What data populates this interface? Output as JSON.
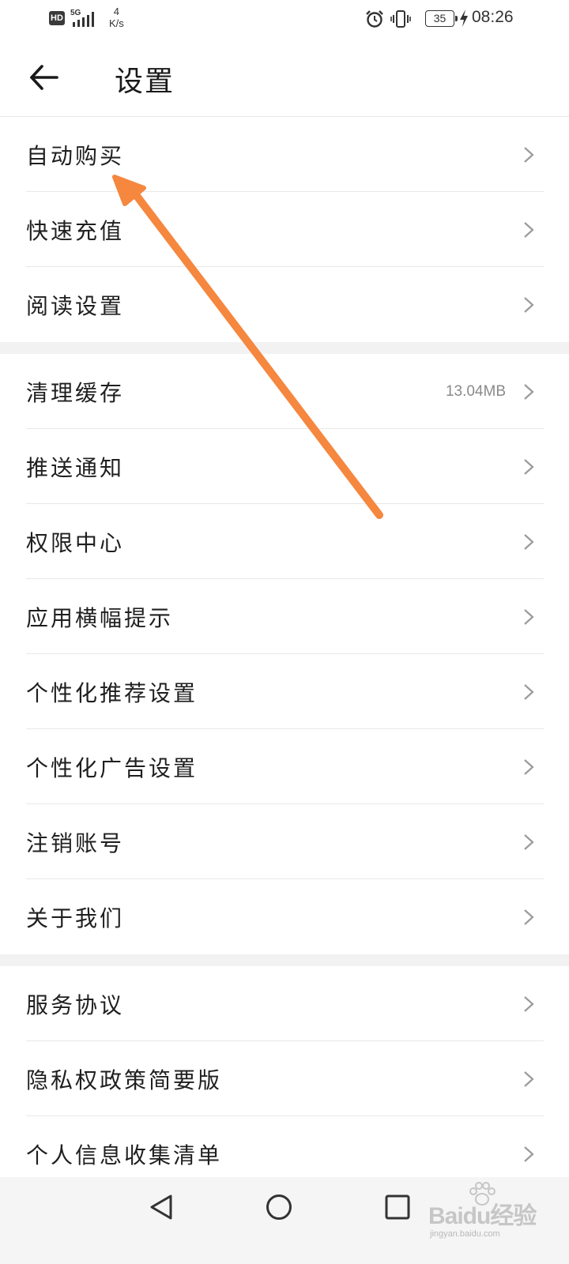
{
  "status_bar": {
    "hd": "HD",
    "network": "5G",
    "speed_value": "4",
    "speed_unit": "K/s",
    "battery": "35",
    "time": "08:26"
  },
  "header": {
    "title": "设置"
  },
  "sections": [
    {
      "items": [
        {
          "label": "自动购买"
        },
        {
          "label": "快速充值"
        },
        {
          "label": "阅读设置"
        }
      ]
    },
    {
      "items": [
        {
          "label": "清理缓存",
          "value": "13.04MB"
        },
        {
          "label": "推送通知"
        },
        {
          "label": "权限中心"
        },
        {
          "label": "应用横幅提示"
        },
        {
          "label": "个性化推荐设置"
        },
        {
          "label": "个性化广告设置"
        },
        {
          "label": "注销账号"
        },
        {
          "label": "关于我们"
        }
      ]
    },
    {
      "items": [
        {
          "label": "服务协议"
        },
        {
          "label": "隐私权政策简要版"
        },
        {
          "label": "个人信息收集清单"
        }
      ]
    }
  ],
  "watermark": {
    "brand": "Baidu经验",
    "url": "jingyan.baidu.com"
  },
  "colors": {
    "annotation_arrow": "#f5873f",
    "divider": "#e8e8e8",
    "section_gap": "#f2f2f2"
  }
}
